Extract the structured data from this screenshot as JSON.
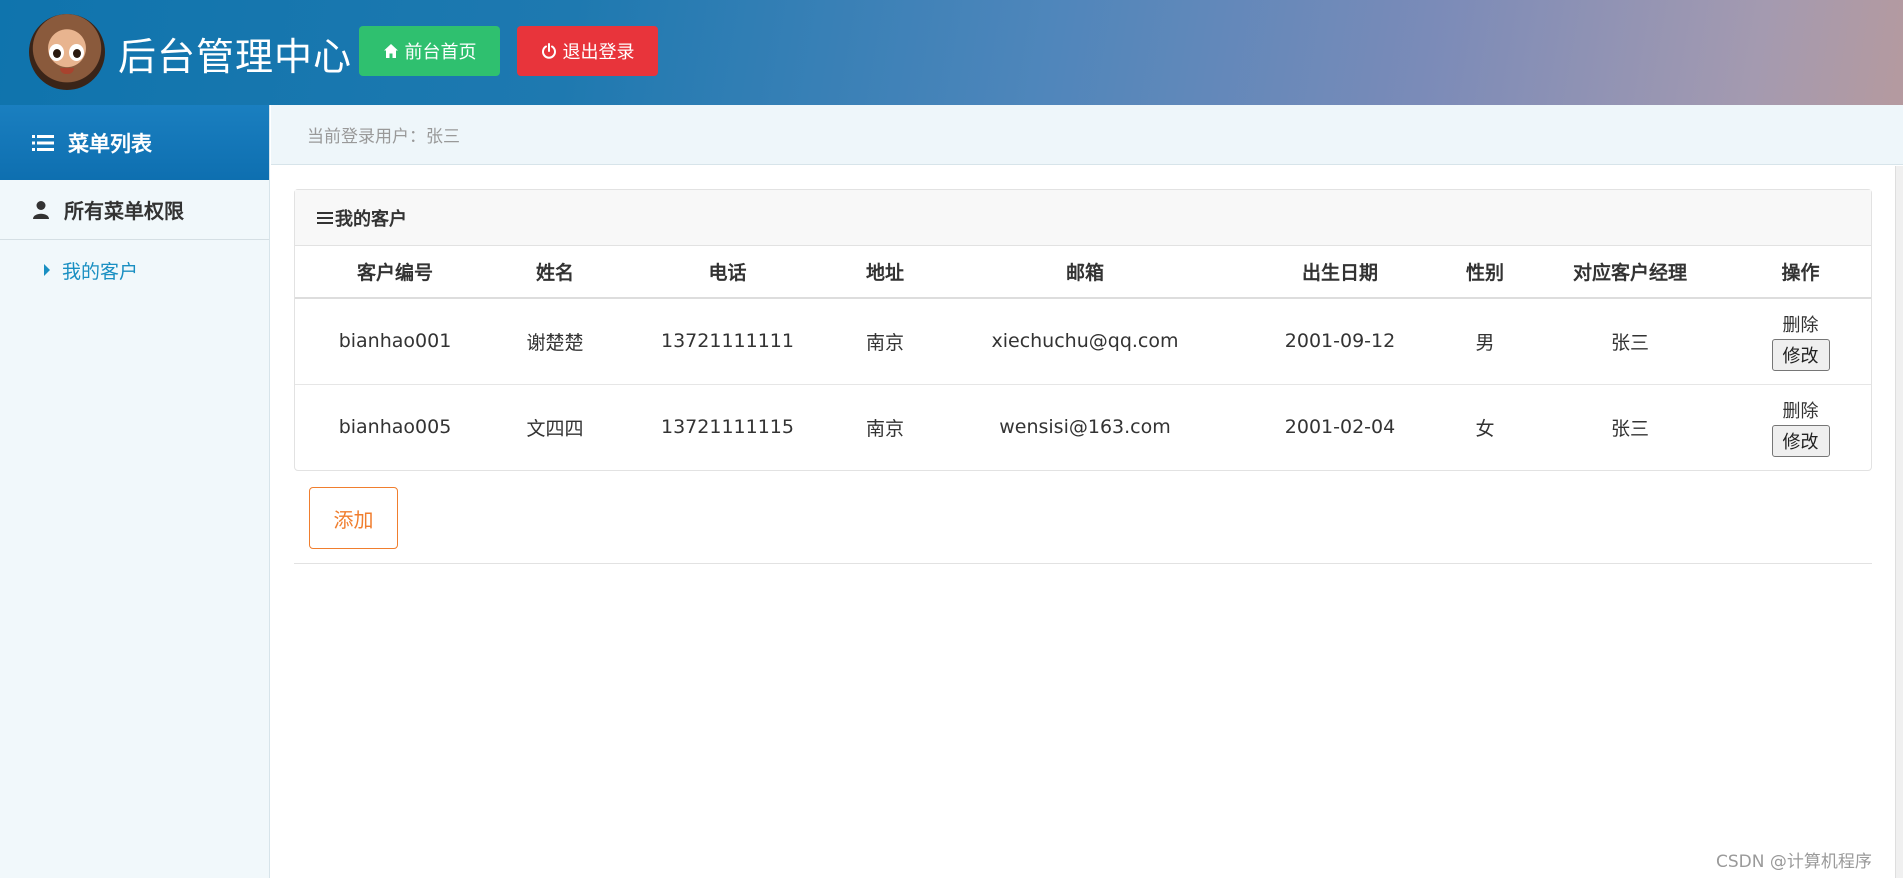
{
  "header": {
    "title": "后台管理中心",
    "home_label": "前台首页",
    "logout_label": "退出登录",
    "gradient_start": "#0f74ad",
    "gradient_end": "#b59a9f"
  },
  "sidebar": {
    "heading": "菜单列表",
    "group": "所有菜单权限",
    "items": [
      {
        "label": "我的客户"
      }
    ]
  },
  "topbar": {
    "current_user": "当前登录用户：张三"
  },
  "panel": {
    "title": "我的客户",
    "columns": [
      "客户编号",
      "姓名",
      "电话",
      "地址",
      "邮箱",
      "出生日期",
      "性别",
      "对应客户经理",
      "操作"
    ],
    "rows": [
      {
        "id": "bianhao001",
        "name": "谢楚楚",
        "phone": "13721111111",
        "address": "南京",
        "email": "xiechuchu@qq.com",
        "birth": "2001-09-12",
        "gender": "男",
        "manager": "张三",
        "delete": "删除",
        "edit": "修改"
      },
      {
        "id": "bianhao005",
        "name": "文四四",
        "phone": "13721111115",
        "address": "南京",
        "email": "wensisi@163.com",
        "birth": "2001-02-04",
        "gender": "女",
        "manager": "张三",
        "delete": "删除",
        "edit": "修改"
      }
    ]
  },
  "add_label": "添加",
  "watermark": "CSDN @计算机程序",
  "colors": {
    "home": "#2fc06f",
    "logout": "#e8343b",
    "accent": "#1a8fc2",
    "add": "#f07e2e"
  },
  "icons": {
    "home": "home-icon",
    "logout": "power-icon",
    "menu": "list-icon",
    "group": "user-icon",
    "panel": "bars-icon"
  }
}
